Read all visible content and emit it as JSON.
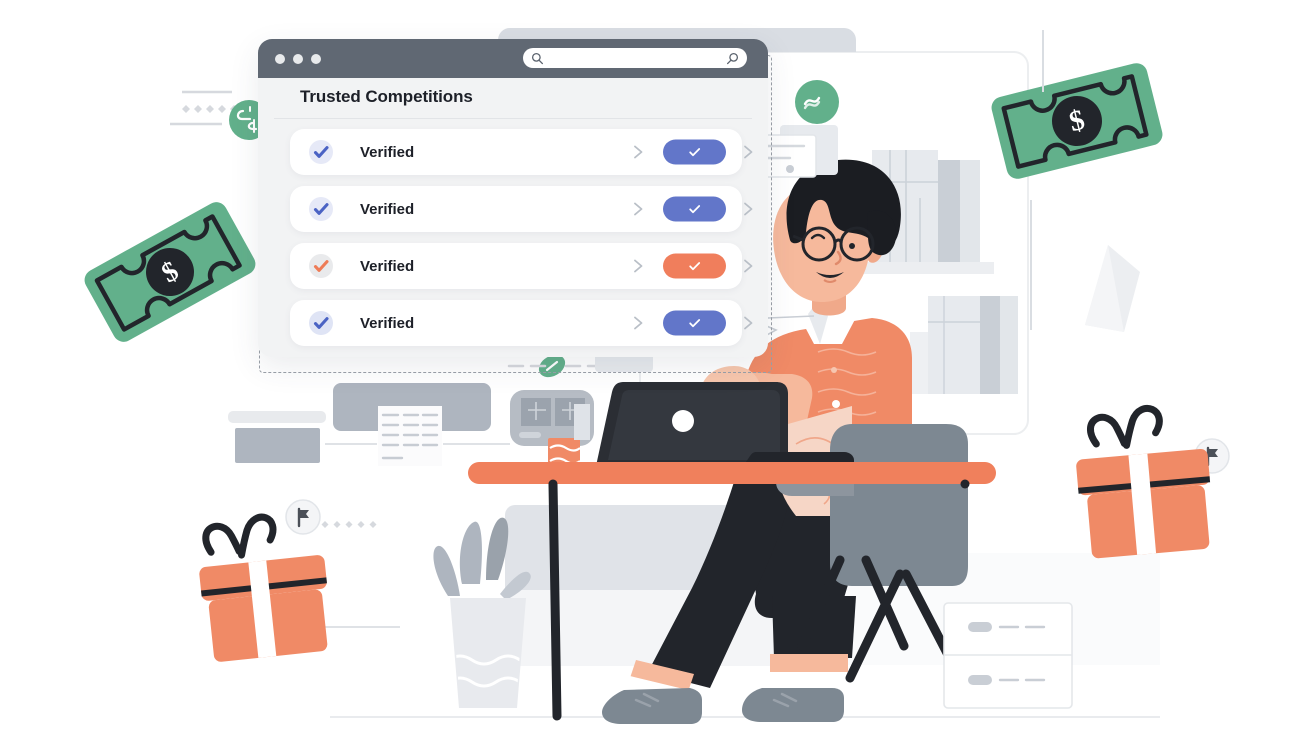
{
  "scene": {
    "type": "illustration",
    "subject": "person at desk with laptop reviewing a verified competitions list",
    "background_color": "#ffffff"
  },
  "browser_window": {
    "chrome_color": "#606873",
    "traffic_lights": [
      "dot-1",
      "dot-2",
      "dot-3"
    ],
    "search": {
      "value": "",
      "placeholder": "",
      "left_icon": "search-icon",
      "right_icon": "search-icon"
    },
    "title": "Trusted Competitions",
    "rows": [
      {
        "label": "Verified",
        "check_color": "#4b63c4",
        "check_bg": "#e6e9f7",
        "pill_color": "#6276c9",
        "pill_icon": "check-icon"
      },
      {
        "label": "Verified",
        "check_color": "#4b63c4",
        "check_bg": "#e6e9f7",
        "pill_color": "#6276c9",
        "pill_icon": "check-icon"
      },
      {
        "label": "Verified",
        "check_color": "#ee7c57",
        "check_bg": "#e9eaec",
        "pill_color": "#f07e5c",
        "pill_icon": "check-icon"
      },
      {
        "label": "Verified",
        "check_color": "#4b63c4",
        "check_bg": "#dfe4f5",
        "pill_color": "#6276c9",
        "pill_icon": "check-icon"
      }
    ]
  },
  "palette": {
    "coral": "#f07e5c",
    "coral_dark": "#e8714c",
    "blue": "#6276c9",
    "green": "#62b08b",
    "ink": "#22252b",
    "gray_chair": "#7d8892",
    "gray_light": "#e6e8ec",
    "gray_mid": "#aeb5bf",
    "skin": "#f6b99c",
    "skin_light": "#f8c7ad",
    "paper": "#f2f3f4"
  },
  "objects": {
    "banknote_left": {
      "name": "banknote",
      "color": "#62b08b",
      "symbol": "$"
    },
    "banknote_right": {
      "name": "banknote",
      "color": "#62b08b",
      "symbol": "$"
    },
    "gift_left": {
      "name": "gift-box",
      "color": "#f07e5c",
      "ribbon": "#22252b"
    },
    "gift_right": {
      "name": "gift-box",
      "color": "#f07e5c",
      "ribbon": "#22252b"
    },
    "badge_currency": {
      "name": "currency-exchange-badge",
      "color": "#62b08b"
    },
    "badges_wave": [
      {
        "name": "wave-badge",
        "color": "#62b08b"
      },
      {
        "name": "wave-badge",
        "color": "#62b08b"
      }
    ],
    "badges_flag": [
      {
        "name": "flag-badge",
        "color": "#f2f3f4"
      },
      {
        "name": "flag-badge",
        "color": "#f2f3f4"
      }
    ],
    "desk": {
      "name": "desk",
      "top_color": "#f07e5c",
      "leg_color": "#22252b"
    },
    "laptop": {
      "name": "laptop",
      "color": "#2b2e34"
    },
    "chair": {
      "name": "office-chair",
      "color": "#7d8892"
    },
    "plant": {
      "name": "potted-plant",
      "pot_color": "#e8eaee",
      "leaf_color": "#aeb5bf"
    },
    "cabinet": {
      "name": "drawer-cabinet",
      "drawers": 2
    },
    "mug": {
      "name": "mug",
      "color": "#f07e5c"
    },
    "keyboard": {
      "name": "keyboard",
      "color": "#aeb5bf"
    }
  },
  "person": {
    "hair": "#1b1d22",
    "shirt": "#f08a66",
    "pants": "#22252b",
    "shoes": "#7d8892",
    "glasses": "#22252b",
    "skin": "#f6b99c"
  }
}
